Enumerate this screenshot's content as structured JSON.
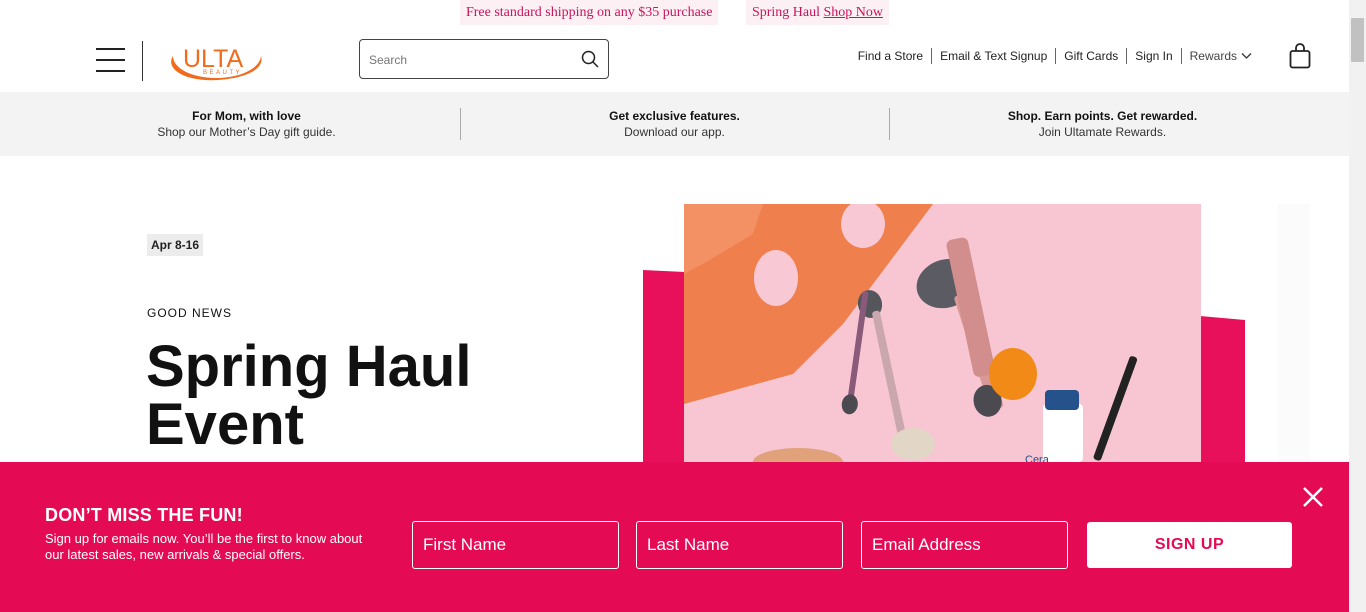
{
  "announcement": {
    "shipping_text": "Free standard shipping on any $35 purchase",
    "event_text": "Spring Haul",
    "event_link": "Shop Now"
  },
  "header": {
    "logo_text": "ULTA",
    "logo_sub": "BEAUTY",
    "search_placeholder": "Search",
    "nav": [
      "Find a Store",
      "Email & Text Signup",
      "Gift Cards",
      "Sign In",
      "Rewards"
    ]
  },
  "promos": [
    {
      "title": "For Mom, with love",
      "subtitle": "Shop our Mother’s Day gift guide."
    },
    {
      "title": "Get exclusive features.",
      "subtitle": "Download our app."
    },
    {
      "title": "Shop. Earn points. Get rewarded.",
      "subtitle": "Join Ultamate Rewards."
    }
  ],
  "hero": {
    "date_badge": "Apr 8-16",
    "eyebrow": "GOOD NEWS",
    "title": "Spring Haul Event",
    "product_label": "Cera"
  },
  "signup": {
    "heading": "DON’T MISS THE FUN!",
    "body": "Sign up for emails now. You’ll be the first to know about our latest sales, new arrivals & special offers.",
    "first_name_placeholder": "First Name",
    "last_name_placeholder": "Last Name",
    "email_placeholder": "Email Address",
    "button_label": "SIGN UP"
  },
  "colors": {
    "brand_pink": "#e50a54",
    "logo_orange": "#f26b1d",
    "announce_text": "#c8145a"
  }
}
